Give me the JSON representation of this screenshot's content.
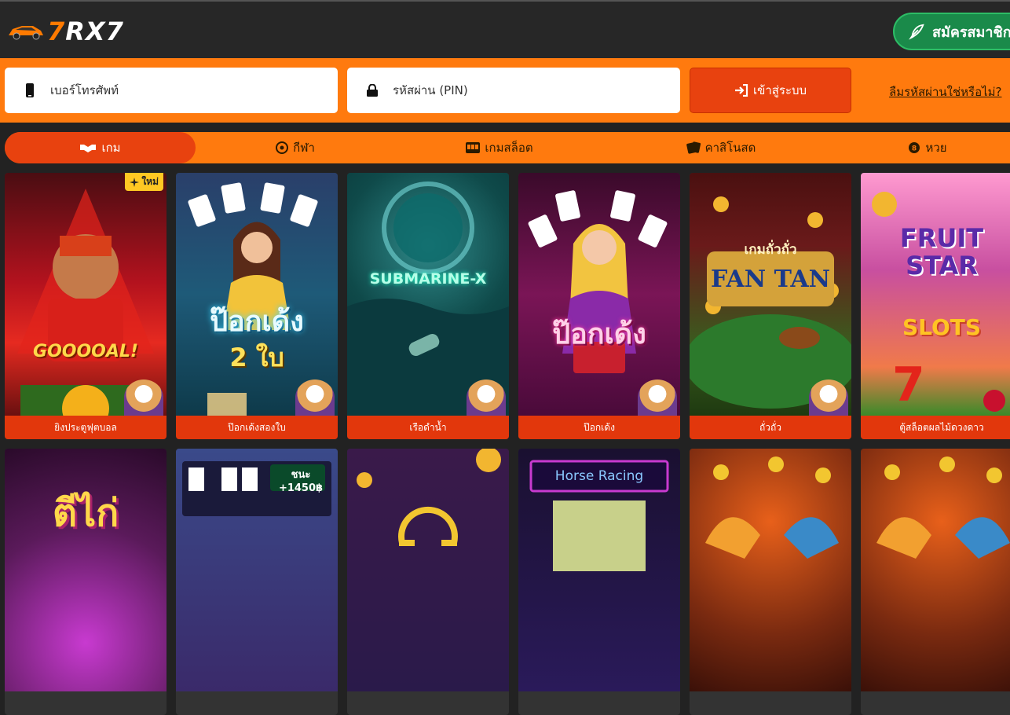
{
  "header": {
    "logo_text_a": "7",
    "logo_text_b": "RX7",
    "register_label": "สมัครสมาชิก"
  },
  "login": {
    "phone_placeholder": "เบอร์โทรศัพท์",
    "pin_placeholder": "รหัสผ่าน (PIN)",
    "login_label": "เข้าสู่ระบบ",
    "forgot_label": "ลืมรหัสผ่านใช่หรือไม่?"
  },
  "tabs": [
    {
      "label": "เกม",
      "icon": "handshake-icon"
    },
    {
      "label": "กีฬา",
      "icon": "soccer-ball-icon"
    },
    {
      "label": "เกมสล็อต",
      "icon": "slot-machine-icon"
    },
    {
      "label": "คาสิโนสด",
      "icon": "cards-icon"
    },
    {
      "label": "หวย",
      "icon": "lottery-ball-icon"
    }
  ],
  "games": [
    {
      "label": "ยิงประตูฟุตบอล",
      "badge": "ใหม่",
      "title": "GOOOOAL!",
      "bg": "#b3121e"
    },
    {
      "label": "ป๊อกเด้งสองใบ",
      "title": "ป๊อกเด้ง",
      "subtitle": "2 ใบ",
      "bg": "#1e5a78"
    },
    {
      "label": "เรือดำน้ำ",
      "title": "SUBMARINE-X",
      "bg": "#0f4a4a"
    },
    {
      "label": "ป๊อกเด้ง",
      "title": "ป๊อกเด้ง",
      "bg": "#7a1556"
    },
    {
      "label": "ถั่วถั่ว",
      "title": "FAN TAN",
      "subtitle": "เกมถั่วถั่ว",
      "bg": "#3b5a1e"
    },
    {
      "label": "ตู้สล็อตผลไม้ดวงดาว",
      "title": "FRUIT STAR",
      "subtitle": "SLOTS",
      "bg": "#c84fa0"
    }
  ],
  "games_row2": [
    {
      "title": "ตีไก่",
      "bg": "#5a1a5a"
    },
    {
      "title": "ชนะ +1450฿",
      "bg": "#3a2a6a"
    },
    {
      "title": "",
      "bg": "#2a1a4a"
    },
    {
      "title": "Horse Racing",
      "bg": "#1a1030"
    },
    {
      "title": "",
      "bg": "#7a2a10"
    },
    {
      "title": "",
      "bg": "#7a2a10"
    }
  ]
}
